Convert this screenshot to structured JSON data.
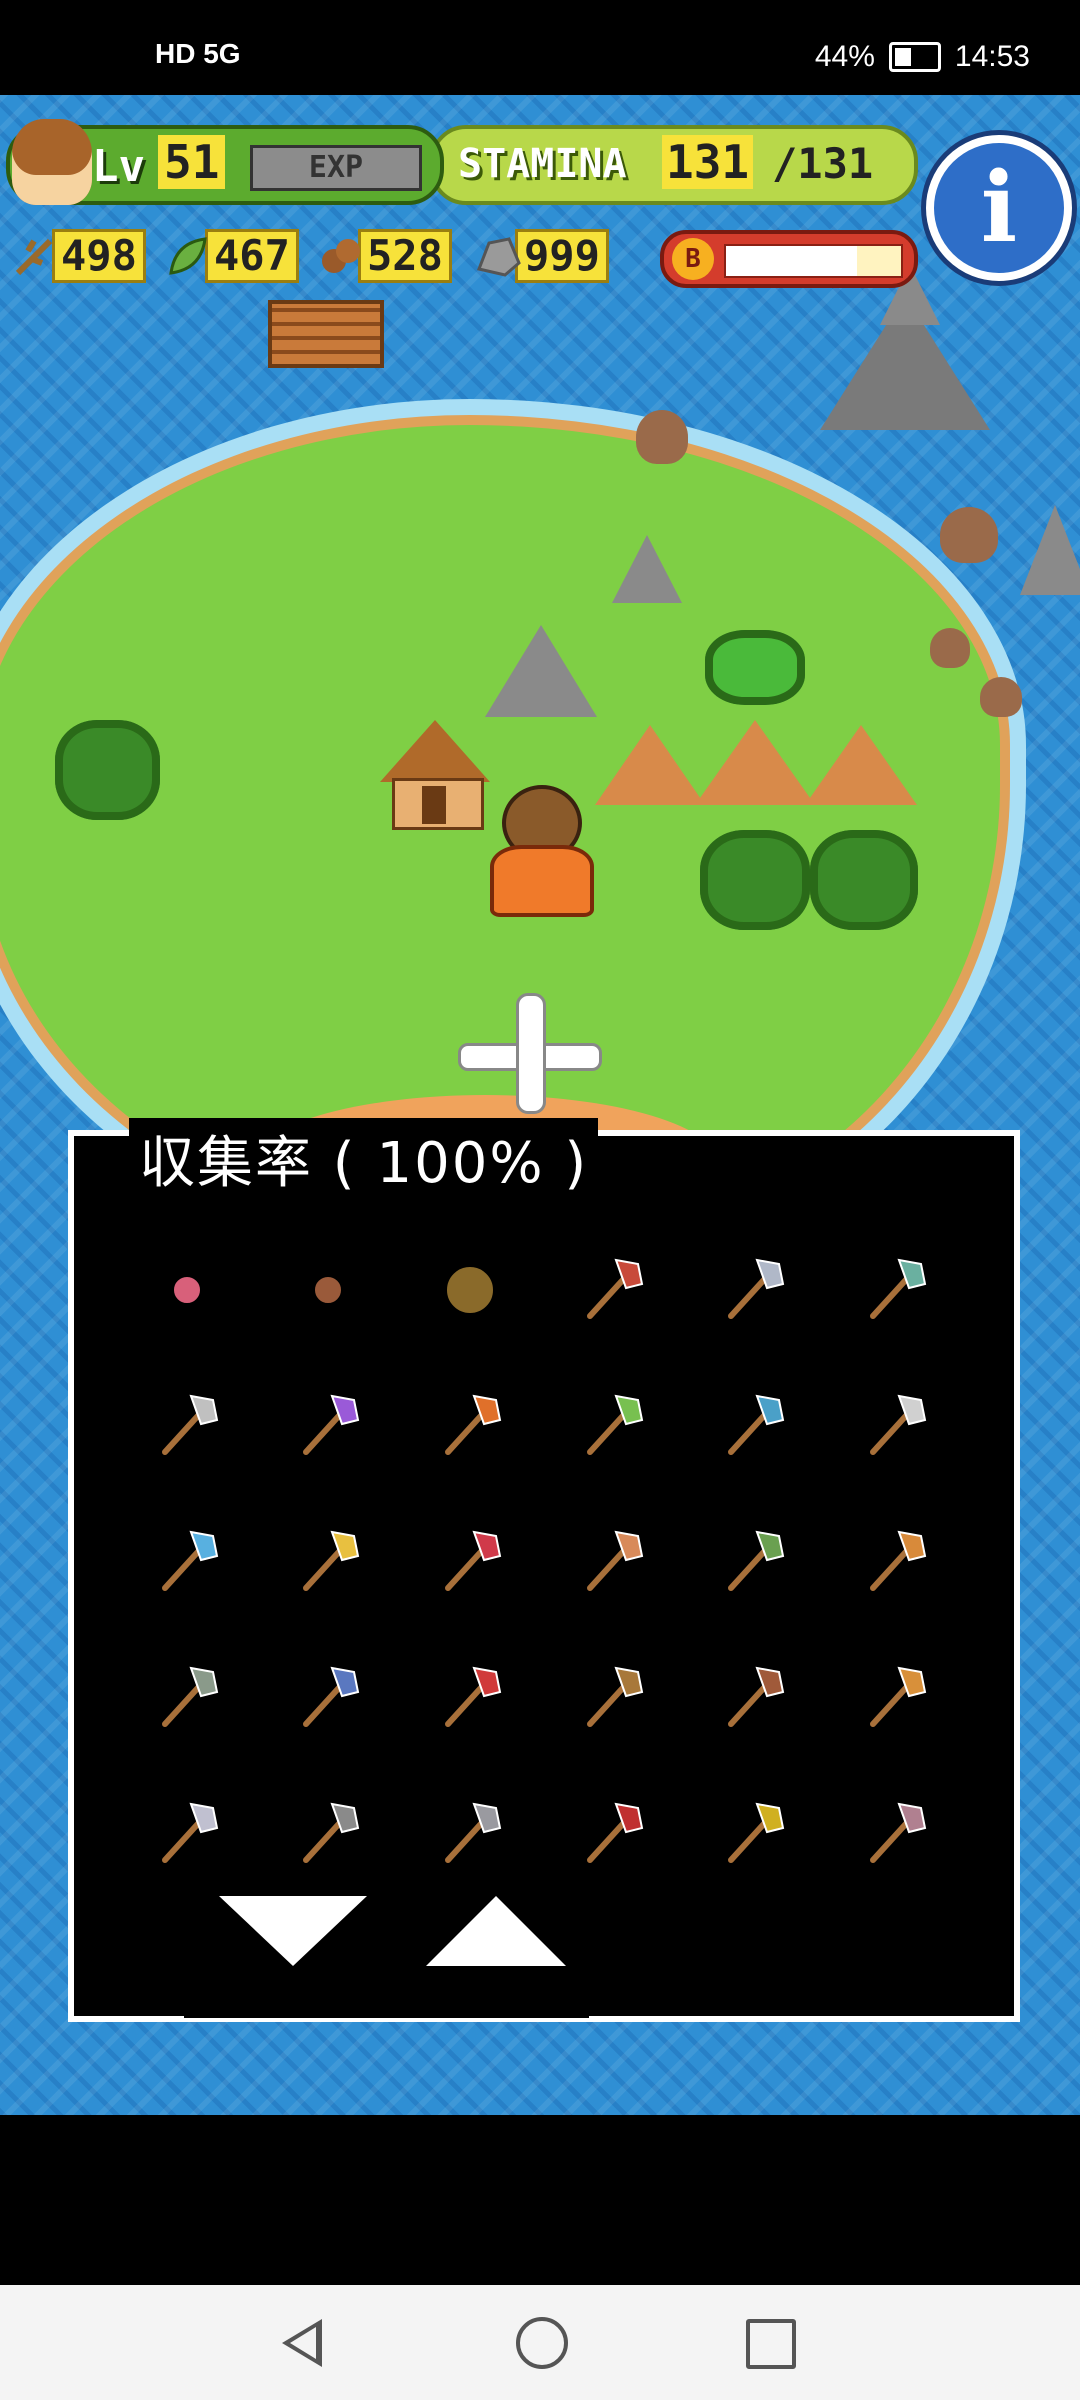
{
  "status_bar": {
    "network": "HD 5G",
    "battery": "44%",
    "time": "14:53"
  },
  "hud": {
    "level_label": "Lv",
    "level": "51",
    "exp_label": "EXP",
    "stamina_label": "STAMINA",
    "stamina_current": "131",
    "stamina_max": "/131",
    "info_icon": "i",
    "boost_icon": "B"
  },
  "resources": [
    {
      "name": "branch-icon",
      "value": "498"
    },
    {
      "name": "leaf-icon",
      "value": "467"
    },
    {
      "name": "nuts-icon",
      "value": "528"
    },
    {
      "name": "stone-icon",
      "value": "999"
    }
  ],
  "boost_level": 0.75,
  "panel": {
    "title": "収集率 ( 100% )",
    "items": [
      "worm-icon",
      "seeds-icon",
      "coconut-icon",
      "stone-axe-icon",
      "iron-axe-icon",
      "steel-axe-icon",
      "pick-axe-icon",
      "purple-axe-icon",
      "flame-axe-icon",
      "vine-fishing-rod-icon",
      "fishing-rod-icon",
      "fishing-rod-2-icon",
      "blue-fishing-rod-icon",
      "gold-fishing-rod-icon",
      "red-fishing-rod-icon",
      "copper-shovel-icon",
      "green-shovel-icon",
      "bronze-shovel-icon",
      "gray-shovel-icon",
      "blue-shovel-icon",
      "red-shovel-icon",
      "stick-icon",
      "hammer-icon",
      "mortar-icon",
      "knife-icon",
      "cleaver-icon",
      "sledgehammer-icon",
      "saw-icon",
      "gold-cleaver-icon",
      "needle-icon"
    ],
    "item_colors": [
      "#d8607a",
      "#9a5a3a",
      "#8a6a2a",
      "#c84a3a",
      "#b0b8c8",
      "#6ab0a0",
      "#c0c0c0",
      "#9a5ad8",
      "#e0702a",
      "#78c050",
      "#4aa0c8",
      "#d0d0d0",
      "#58b0e0",
      "#e8c040",
      "#d03a4a",
      "#d88a5a",
      "#6aa050",
      "#d88a3a",
      "#8a9a8a",
      "#5a78c0",
      "#d03a3a",
      "#a8783a",
      "#a05a3a",
      "#d8903a",
      "#c0c0d0",
      "#8a8a8a",
      "#9a9aa0",
      "#c03030",
      "#d0b020",
      "#b08090"
    ]
  },
  "colors": {
    "water": "#2f8fd4",
    "grass": "#7fcf45",
    "panel_border": "#ffffff"
  }
}
